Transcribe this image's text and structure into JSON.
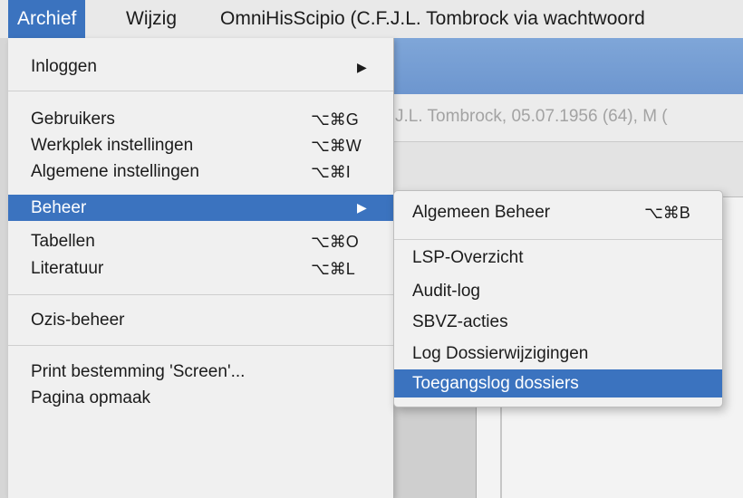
{
  "menubar": {
    "items": [
      "Archief",
      "Wijzig",
      "OmniHisScipio (C.F.J.L. Tombrock via wachtwoord"
    ]
  },
  "window": {
    "patient_strip": "J.L. Tombrock, 05.07.1956 (64), M ("
  },
  "archief_menu": {
    "items": [
      {
        "label": "Inloggen",
        "shortcut": "",
        "submenu": true
      },
      {
        "label": "Gebruikers",
        "shortcut": "⌥⌘G"
      },
      {
        "label": "Werkplek instellingen",
        "shortcut": "⌥⌘W"
      },
      {
        "label": "Algemene instellingen",
        "shortcut": "⌥⌘I"
      },
      {
        "label": "Beheer",
        "shortcut": "",
        "submenu": true,
        "highlighted": true
      },
      {
        "label": "Tabellen",
        "shortcut": "⌥⌘O"
      },
      {
        "label": "Literatuur",
        "shortcut": "⌥⌘L"
      },
      {
        "label": "Ozis-beheer",
        "shortcut": ""
      },
      {
        "label": "Print bestemming  'Screen'...",
        "shortcut": ""
      },
      {
        "label": "Pagina opmaak",
        "shortcut": ""
      }
    ],
    "submenu_arrow": "▶"
  },
  "beheer_submenu": {
    "items": [
      {
        "label": "Algemeen Beheer",
        "shortcut": "⌥⌘B"
      },
      {
        "label": "LSP-Overzicht"
      },
      {
        "label": "Audit-log"
      },
      {
        "label": "SBVZ-acties"
      },
      {
        "label": "Log Dossierwijzigingen"
      },
      {
        "label": "Toegangslog dossiers",
        "highlighted": true
      }
    ]
  },
  "colors": {
    "highlight": "#3b73bf",
    "menu_background": "#f0f0f0",
    "window_titlebar": "#7fa6d8"
  }
}
